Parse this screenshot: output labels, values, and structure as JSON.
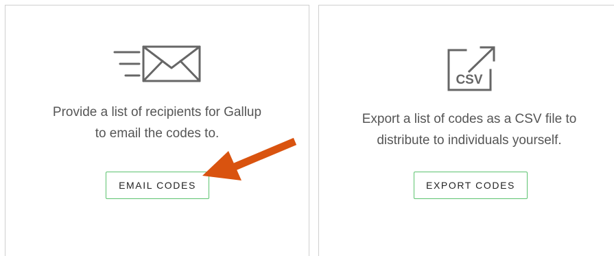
{
  "cards": [
    {
      "icon": "email-envelope-icon",
      "description_line1": "Provide a list of recipients for Gallup",
      "description_line2": "to email the codes to.",
      "button_label": "EMAIL CODES"
    },
    {
      "icon": "csv-export-icon",
      "icon_text": "CSV",
      "description_line1": "Export a list of codes as a CSV file to",
      "description_line2": "distribute to individuals yourself.",
      "button_label": "EXPORT CODES"
    }
  ],
  "annotation": {
    "icon": "orange-arrow-icon",
    "color": "#d9530f",
    "points_to": "EMAIL CODES"
  },
  "colors": {
    "button_border": "#5cc36f",
    "card_border": "#cfcfcf",
    "text": "#555555",
    "icon": "#666666"
  }
}
